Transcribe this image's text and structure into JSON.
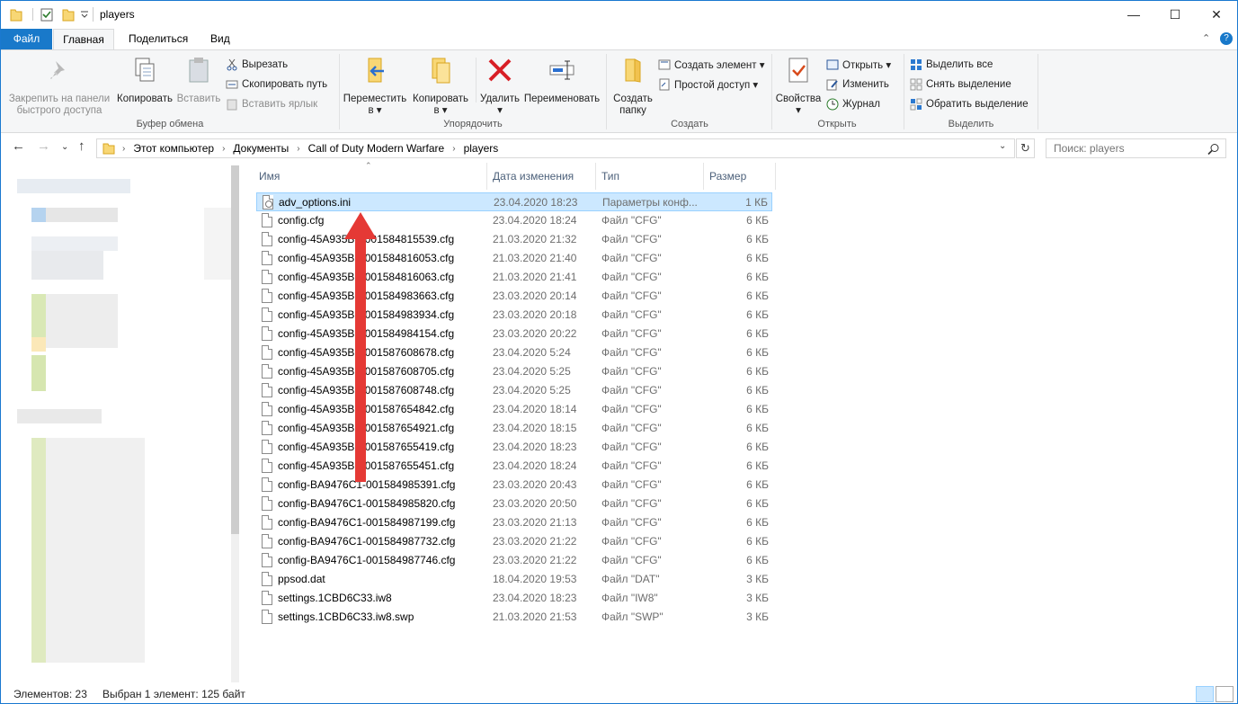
{
  "window": {
    "title": "players"
  },
  "tabs": [
    {
      "label": "Файл"
    },
    {
      "label": "Главная"
    },
    {
      "label": "Поделиться"
    },
    {
      "label": "Вид"
    }
  ],
  "ribbon": {
    "clipboard": {
      "group": "Буфер обмена",
      "pin": "Закрепить на панели\nбыстрого доступа",
      "copy": "Копировать",
      "paste": "Вставить",
      "cut": "Вырезать",
      "copy_path": "Скопировать путь",
      "paste_shortcut": "Вставить ярлык"
    },
    "organize": {
      "group": "Упорядочить",
      "move": "Переместить\nв ▾",
      "copy_to": "Копировать\nв ▾",
      "delete": "Удалить\n▾",
      "rename": "Переименовать"
    },
    "create": {
      "group": "Создать",
      "new_folder": "Создать\nпапку",
      "new_item": "Создать элемент ▾",
      "easy_access": "Простой доступ ▾"
    },
    "open": {
      "group": "Открыть",
      "properties": "Свойства\n▾",
      "open": "Открыть ▾",
      "edit": "Изменить",
      "history": "Журнал"
    },
    "select": {
      "group": "Выделить",
      "select_all": "Выделить все",
      "select_none": "Снять выделение",
      "invert": "Обратить выделение"
    }
  },
  "address": {
    "crumbs": [
      "Этот компьютер",
      "Документы",
      "Call of Duty Modern Warfare",
      "players"
    ],
    "search_placeholder": "Поиск: players"
  },
  "columns": {
    "name": "Имя",
    "date": "Дата изменения",
    "type": "Тип",
    "size": "Размер"
  },
  "files": [
    {
      "name": "adv_options.ini",
      "date": "23.04.2020 18:23",
      "type": "Параметры конф...",
      "size": "1 КБ",
      "selected": true
    },
    {
      "name": "config.cfg",
      "date": "23.04.2020 18:24",
      "type": "Файл \"CFG\"",
      "size": "6 КБ"
    },
    {
      "name": "config-45A935BF-001584815539.cfg",
      "date": "21.03.2020 21:32",
      "type": "Файл \"CFG\"",
      "size": "6 КБ"
    },
    {
      "name": "config-45A935BF-001584816053.cfg",
      "date": "21.03.2020 21:40",
      "type": "Файл \"CFG\"",
      "size": "6 КБ"
    },
    {
      "name": "config-45A935BF-001584816063.cfg",
      "date": "21.03.2020 21:41",
      "type": "Файл \"CFG\"",
      "size": "6 КБ"
    },
    {
      "name": "config-45A935BF-001584983663.cfg",
      "date": "23.03.2020 20:14",
      "type": "Файл \"CFG\"",
      "size": "6 КБ"
    },
    {
      "name": "config-45A935BF-001584983934.cfg",
      "date": "23.03.2020 20:18",
      "type": "Файл \"CFG\"",
      "size": "6 КБ"
    },
    {
      "name": "config-45A935BF-001584984154.cfg",
      "date": "23.03.2020 20:22",
      "type": "Файл \"CFG\"",
      "size": "6 КБ"
    },
    {
      "name": "config-45A935BF-001587608678.cfg",
      "date": "23.04.2020 5:24",
      "type": "Файл \"CFG\"",
      "size": "6 КБ"
    },
    {
      "name": "config-45A935BF-001587608705.cfg",
      "date": "23.04.2020 5:25",
      "type": "Файл \"CFG\"",
      "size": "6 КБ"
    },
    {
      "name": "config-45A935BF-001587608748.cfg",
      "date": "23.04.2020 5:25",
      "type": "Файл \"CFG\"",
      "size": "6 КБ"
    },
    {
      "name": "config-45A935BF-001587654842.cfg",
      "date": "23.04.2020 18:14",
      "type": "Файл \"CFG\"",
      "size": "6 КБ"
    },
    {
      "name": "config-45A935BF-001587654921.cfg",
      "date": "23.04.2020 18:15",
      "type": "Файл \"CFG\"",
      "size": "6 КБ"
    },
    {
      "name": "config-45A935BF-001587655419.cfg",
      "date": "23.04.2020 18:23",
      "type": "Файл \"CFG\"",
      "size": "6 КБ"
    },
    {
      "name": "config-45A935BF-001587655451.cfg",
      "date": "23.04.2020 18:24",
      "type": "Файл \"CFG\"",
      "size": "6 КБ"
    },
    {
      "name": "config-BA9476C1-001584985391.cfg",
      "date": "23.03.2020 20:43",
      "type": "Файл \"CFG\"",
      "size": "6 КБ"
    },
    {
      "name": "config-BA9476C1-001584985820.cfg",
      "date": "23.03.2020 20:50",
      "type": "Файл \"CFG\"",
      "size": "6 КБ"
    },
    {
      "name": "config-BA9476C1-001584987199.cfg",
      "date": "23.03.2020 21:13",
      "type": "Файл \"CFG\"",
      "size": "6 КБ"
    },
    {
      "name": "config-BA9476C1-001584987732.cfg",
      "date": "23.03.2020 21:22",
      "type": "Файл \"CFG\"",
      "size": "6 КБ"
    },
    {
      "name": "config-BA9476C1-001584987746.cfg",
      "date": "23.03.2020 21:22",
      "type": "Файл \"CFG\"",
      "size": "6 КБ"
    },
    {
      "name": "ppsod.dat",
      "date": "18.04.2020 19:53",
      "type": "Файл \"DAT\"",
      "size": "3 КБ"
    },
    {
      "name": "settings.1CBD6C33.iw8",
      "date": "23.04.2020 18:23",
      "type": "Файл \"IW8\"",
      "size": "3 КБ"
    },
    {
      "name": "settings.1CBD6C33.iw8.swp",
      "date": "21.03.2020 21:53",
      "type": "Файл \"SWP\"",
      "size": "3 КБ"
    }
  ],
  "status": {
    "items": "Элементов: 23",
    "selection": "Выбран 1 элемент: 125 байт"
  },
  "colors": {
    "accent": "#1979ca",
    "selection": "#cce8ff",
    "arrow": "#e53935"
  }
}
